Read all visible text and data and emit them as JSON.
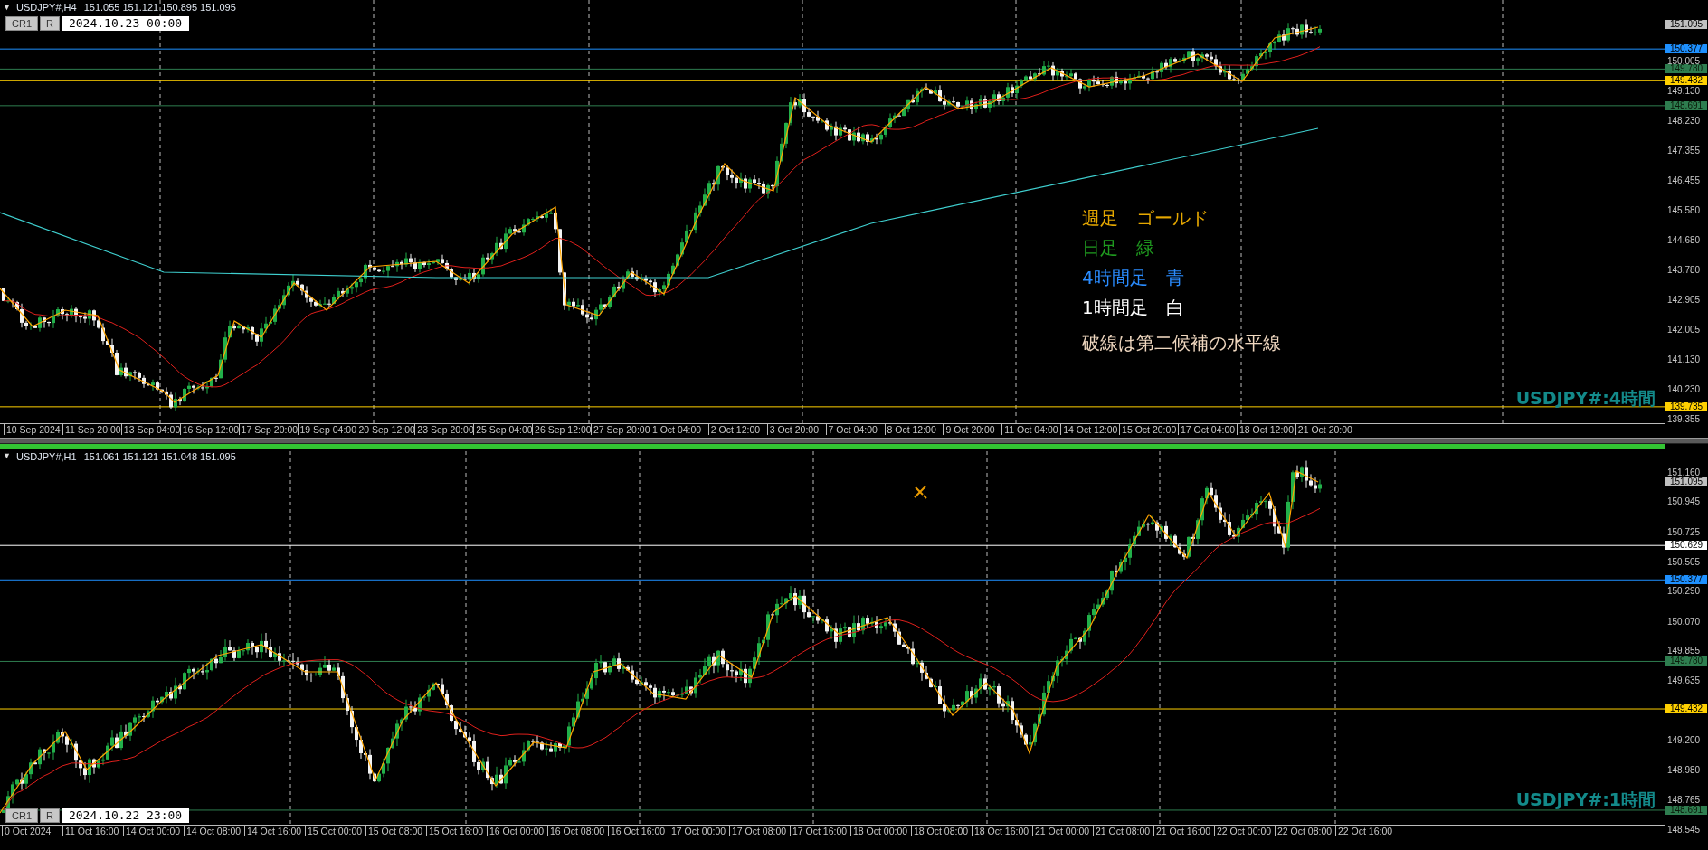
{
  "panes": [
    {
      "menu_glyph": "▼",
      "symbol": "USDJPY#,H4",
      "ohlc": "151.055 151.121 150.895 151.095",
      "buttons": [
        "CR1",
        "R"
      ],
      "date_field": "2024.10.23 00:00",
      "price_ticks": [
        "150.005",
        "149.130",
        "148.230",
        "147.355",
        "146.455",
        "145.580",
        "144.680",
        "143.780",
        "142.905",
        "142.005",
        "141.130",
        "140.230",
        "139.355"
      ],
      "levels": [
        {
          "price": "150.377",
          "color": "#1e90ff"
        },
        {
          "price": "149.780",
          "color": "#2e7d4f"
        },
        {
          "price": "149.432",
          "color": "#ffd000"
        },
        {
          "price": "148.691",
          "color": "#2e7d4f"
        },
        {
          "price": "139.735",
          "color": "#ffd000"
        }
      ],
      "current_price": "151.095",
      "time_labels": [
        "10 Sep 2024",
        "11 Sep 20:00",
        "13 Sep 04:00",
        "16 Sep 12:00",
        "17 Sep 20:00",
        "19 Sep 04:00",
        "20 Sep 12:00",
        "23 Sep 20:00",
        "25 Sep 04:00",
        "26 Sep 12:00",
        "27 Sep 20:00",
        "1 Oct 04:00",
        "2 Oct 12:00",
        "3 Oct 20:00",
        "7 Oct 04:00",
        "8 Oct 12:00",
        "9 Oct 20:00",
        "11 Oct 04:00",
        "14 Oct 12:00",
        "15 Oct 20:00",
        "17 Oct 04:00",
        "18 Oct 12:00",
        "21 Oct 20:00"
      ],
      "notes": [
        {
          "text": "週足　ゴールド",
          "color": "#e6a800"
        },
        {
          "text": "日足　緑",
          "color": "#1f9a1f"
        },
        {
          "text": "4時間足　青",
          "color": "#2a8cff"
        },
        {
          "text": "1時間足　白",
          "color": "#ffffff"
        },
        {
          "text": "破線は第二候補の水平線",
          "color": "#f0d8c0"
        }
      ],
      "chart_label": "USDJPY#:4時間"
    },
    {
      "menu_glyph": "▼",
      "symbol": "USDJPY#,H1",
      "ohlc": "151.061 151.121 151.048 151.095",
      "buttons": [
        "CR1",
        "R"
      ],
      "date_field": "2024.10.22 23:00",
      "price_ticks": [
        "151.160",
        "150.945",
        "150.725",
        "150.505",
        "150.290",
        "150.070",
        "149.855",
        "149.635",
        "149.200",
        "148.980",
        "148.765",
        "148.545"
      ],
      "levels": [
        {
          "price": "150.629",
          "color": "#ffffff"
        },
        {
          "price": "150.377",
          "color": "#1e90ff"
        },
        {
          "price": "149.780",
          "color": "#2e7d4f"
        },
        {
          "price": "149.432",
          "color": "#ffd000"
        },
        {
          "price": "148.691",
          "color": "#2e7d4f"
        }
      ],
      "current_price": "151.095",
      "time_labels": [
        "0 Oct 2024",
        "11 Oct 16:00",
        "14 Oct 00:00",
        "14 Oct 08:00",
        "14 Oct 16:00",
        "15 Oct 00:00",
        "15 Oct 08:00",
        "15 Oct 16:00",
        "16 Oct 00:00",
        "16 Oct 08:00",
        "16 Oct 16:00",
        "17 Oct 00:00",
        "17 Oct 08:00",
        "17 Oct 16:00",
        "18 Oct 00:00",
        "18 Oct 08:00",
        "18 Oct 16:00",
        "21 Oct 00:00",
        "21 Oct 08:00",
        "21 Oct 16:00",
        "22 Oct 00:00",
        "22 Oct 08:00",
        "22 Oct 16:00"
      ],
      "chart_label": "USDJPY#:1時間"
    }
  ]
}
